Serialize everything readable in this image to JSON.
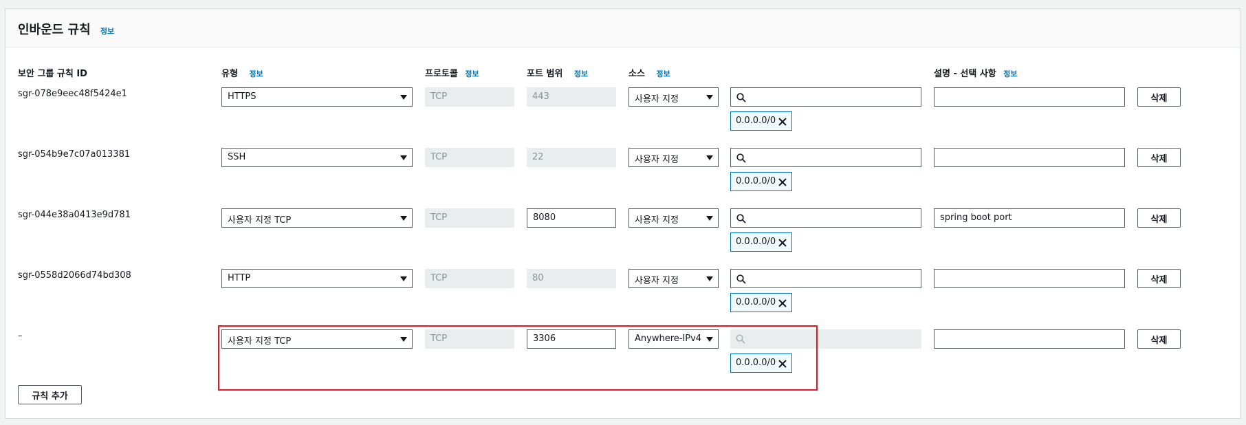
{
  "section": {
    "title": "인바운드 규칙",
    "info": "정보"
  },
  "columns": {
    "rule_id": "보안 그룹 규칙 ID",
    "type": "유형",
    "protocol": "프로토콜",
    "port_range": "포트 범위",
    "source": "소스",
    "description": "설명 - 선택 사항",
    "info": "정보"
  },
  "rules": [
    {
      "id": "sgr-078e9eec48f5424e1",
      "type": "HTTPS",
      "protocol": "TCP",
      "port": "443",
      "source": "사용자 지정",
      "cidr": "0.0.0.0/0",
      "description": "",
      "delete": "삭제"
    },
    {
      "id": "sgr-054b9e7c07a013381",
      "type": "SSH",
      "protocol": "TCP",
      "port": "22",
      "source": "사용자 지정",
      "cidr": "0.0.0.0/0",
      "description": "",
      "delete": "삭제"
    },
    {
      "id": "sgr-044e38a0413e9d781",
      "type": "사용자 지정 TCP",
      "protocol": "TCP",
      "port": "8080",
      "source": "사용자 지정",
      "cidr": "0.0.0.0/0",
      "description": "spring boot port",
      "delete": "삭제"
    },
    {
      "id": "sgr-0558d2066d74bd308",
      "type": "HTTP",
      "protocol": "TCP",
      "port": "80",
      "source": "사용자 지정",
      "cidr": "0.0.0.0/0",
      "description": "",
      "delete": "삭제"
    },
    {
      "id": "–",
      "type": "사용자 지정 TCP",
      "protocol": "TCP",
      "port": "3306",
      "source": "Anywhere-IPv4",
      "cidr": "0.0.0.0/0",
      "description": "",
      "delete": "삭제"
    }
  ],
  "add_rule": "규칙 추가",
  "colors": {
    "link": "#0073bb",
    "highlight": "#e8171f",
    "token_border": "#0073bb"
  }
}
